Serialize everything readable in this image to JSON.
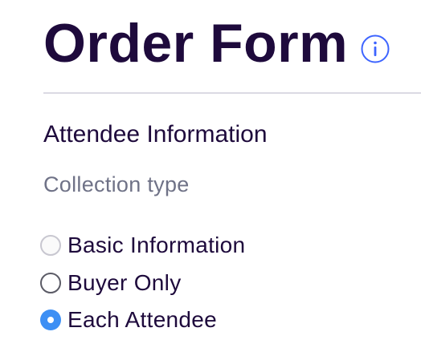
{
  "header": {
    "title": "Order Form",
    "info_icon": "info-circle-icon"
  },
  "section": {
    "title": "Attendee Information",
    "collection_label": "Collection type",
    "selected": "Each Attendee",
    "options": [
      {
        "label": "Basic Information",
        "checked": false
      },
      {
        "label": "Buyer Only",
        "checked": false
      },
      {
        "label": "Each Attendee",
        "checked": true
      }
    ]
  },
  "colors": {
    "title_text": "#1e0a3c",
    "label_text": "#6f7287",
    "accent": "#3d8ff4",
    "divider": "#dbdae3"
  }
}
